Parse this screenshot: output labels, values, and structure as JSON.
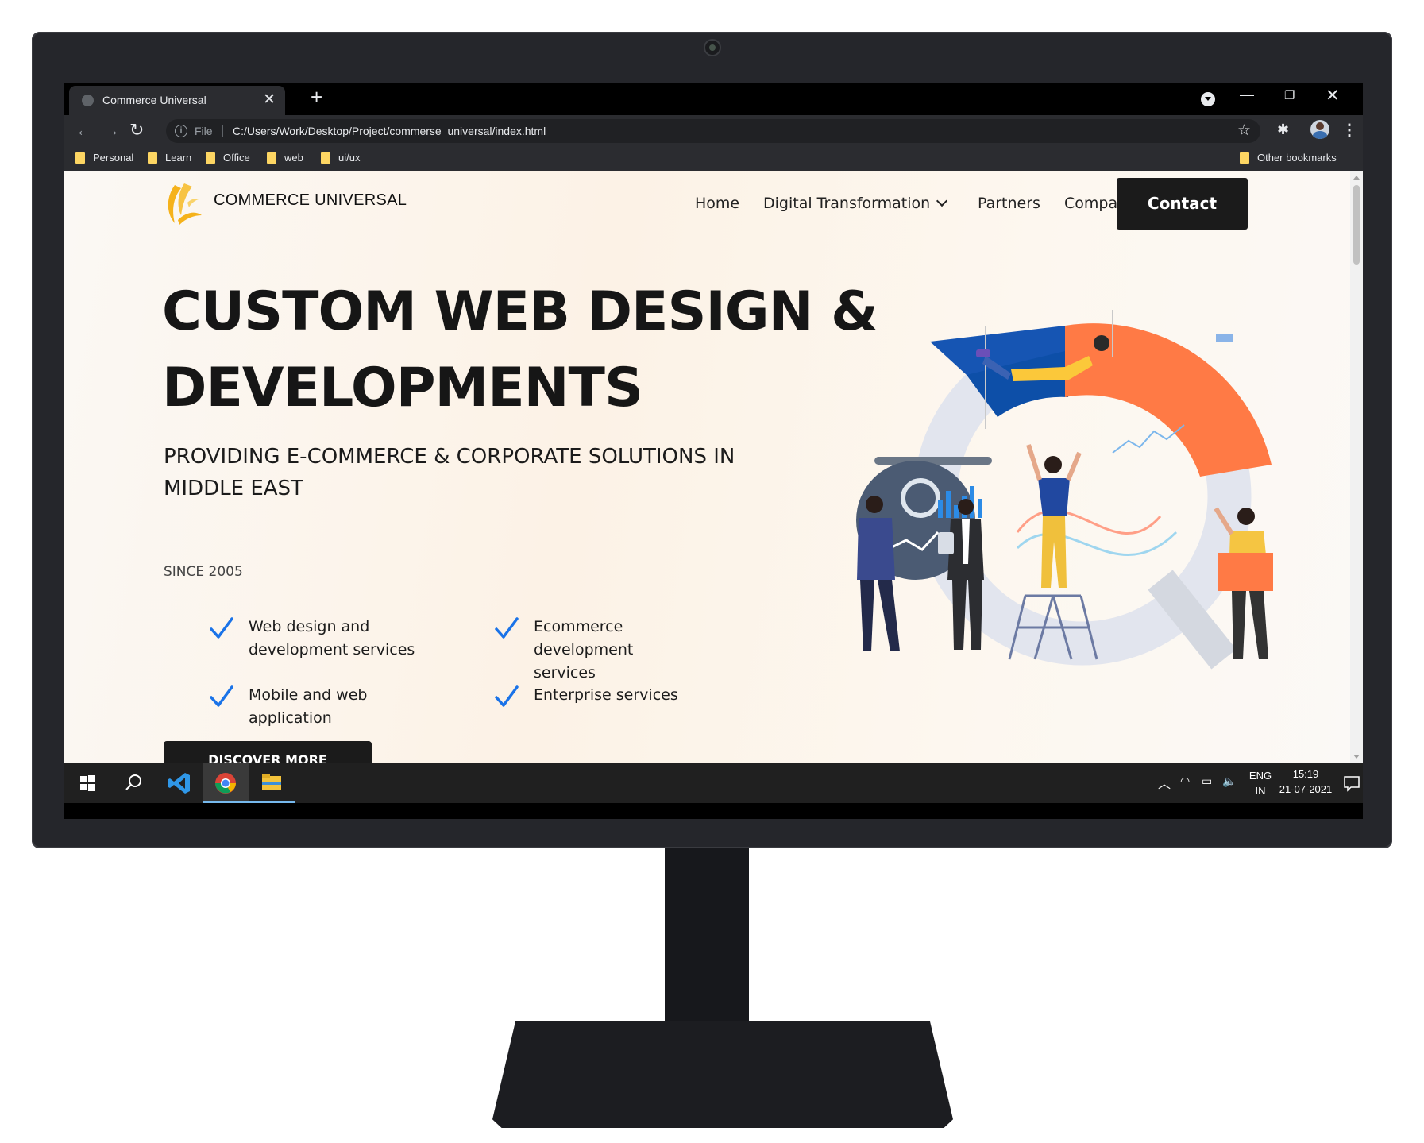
{
  "browser": {
    "tab_title": "Commerce Universal",
    "tab_close": "✕",
    "new_tab": "+",
    "file_label": "File",
    "url": "C:/Users/Work/Desktop/Project/commerse_universal/index.html",
    "bookmarks": [
      "Personal",
      "Learn",
      "Office",
      "web",
      "ui/ux"
    ],
    "other_bookmarks": "Other bookmarks"
  },
  "site": {
    "brand": "COMMERCE UNIVERSAL",
    "nav": [
      "Home",
      "Digital Transformation",
      "Partners",
      "Company"
    ],
    "contact_label": "Contact",
    "hero_line1": "CUSTOM WEB DESIGN &",
    "hero_line2": "DEVELOPMENTS",
    "subtitle_line1": "PROVIDING E-COMMERCE & CORPORATE SOLUTIONS IN",
    "subtitle_line2": "MIDDLE EAST",
    "since": "SINCE 2005",
    "services": [
      {
        "line1": "Web design and",
        "line2": "development services"
      },
      {
        "line1": "Ecommerce development",
        "line2": "services"
      },
      {
        "line1": "Mobile and web",
        "line2": "application"
      },
      {
        "line1": "Enterprise services",
        "line2": ""
      }
    ],
    "discover_label": "DISCOVER MORE"
  },
  "taskbar": {
    "lang": "ENG",
    "region": "IN",
    "time": "15:19",
    "date": "21-07-2021"
  },
  "colors": {
    "accent_check": "#1a73e8",
    "logo_yellow": "#f5b21b",
    "dark_button": "#1b1b1b"
  }
}
